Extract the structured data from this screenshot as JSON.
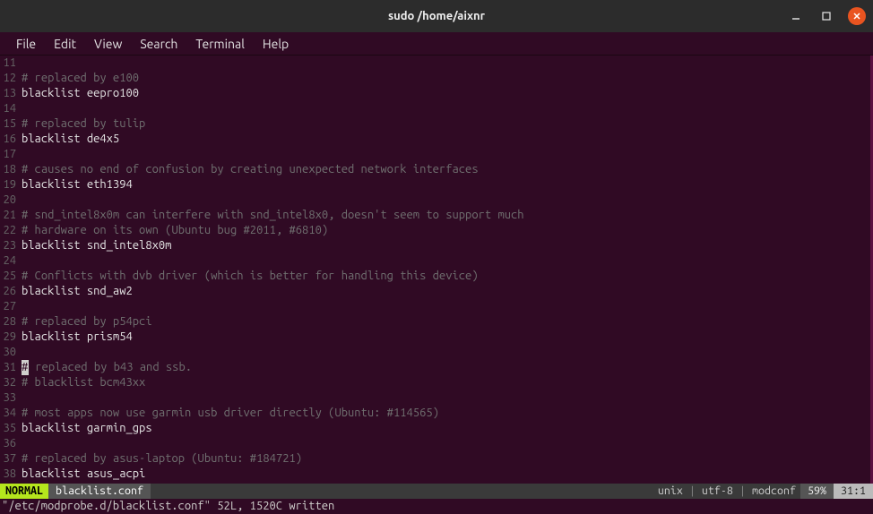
{
  "window": {
    "title": "sudo  /home/aixnr"
  },
  "menu": {
    "file": "File",
    "edit": "Edit",
    "view": "View",
    "search": "Search",
    "terminal": "Terminal",
    "help": "Help"
  },
  "editor": {
    "cursor_line": 31,
    "cursor_col": 1,
    "cursor_char": "#",
    "lines": [
      {
        "n": 11,
        "type": "blank",
        "text": ""
      },
      {
        "n": 12,
        "type": "comment",
        "text": "# replaced by e100"
      },
      {
        "n": 13,
        "type": "blacklist",
        "kw": "blacklist",
        "mod": "eepro100"
      },
      {
        "n": 14,
        "type": "blank",
        "text": ""
      },
      {
        "n": 15,
        "type": "comment",
        "text": "# replaced by tulip"
      },
      {
        "n": 16,
        "type": "blacklist",
        "kw": "blacklist",
        "mod": "de4x5"
      },
      {
        "n": 17,
        "type": "blank",
        "text": ""
      },
      {
        "n": 18,
        "type": "comment",
        "text": "# causes no end of confusion by creating unexpected network interfaces"
      },
      {
        "n": 19,
        "type": "blacklist",
        "kw": "blacklist",
        "mod": "eth1394"
      },
      {
        "n": 20,
        "type": "blank",
        "text": ""
      },
      {
        "n": 21,
        "type": "comment",
        "text": "# snd_intel8x0m can interfere with snd_intel8x0, doesn't seem to support much"
      },
      {
        "n": 22,
        "type": "comment",
        "text": "# hardware on its own (Ubuntu bug #2011, #6810)"
      },
      {
        "n": 23,
        "type": "blacklist",
        "kw": "blacklist",
        "mod": "snd_intel8x0m"
      },
      {
        "n": 24,
        "type": "blank",
        "text": ""
      },
      {
        "n": 25,
        "type": "comment",
        "text": "# Conflicts with dvb driver (which is better for handling this device)"
      },
      {
        "n": 26,
        "type": "blacklist",
        "kw": "blacklist",
        "mod": "snd_aw2"
      },
      {
        "n": 27,
        "type": "blank",
        "text": ""
      },
      {
        "n": 28,
        "type": "comment",
        "text": "# replaced by p54pci"
      },
      {
        "n": 29,
        "type": "blacklist",
        "kw": "blacklist",
        "mod": "prism54"
      },
      {
        "n": 30,
        "type": "blank",
        "text": ""
      },
      {
        "n": 31,
        "type": "cursor_comment",
        "rest": " replaced by b43 and ssb."
      },
      {
        "n": 32,
        "type": "comment",
        "text": "# blacklist bcm43xx"
      },
      {
        "n": 33,
        "type": "blank",
        "text": ""
      },
      {
        "n": 34,
        "type": "comment",
        "text": "# most apps now use garmin usb driver directly (Ubuntu: #114565)"
      },
      {
        "n": 35,
        "type": "blacklist",
        "kw": "blacklist",
        "mod": "garmin_gps"
      },
      {
        "n": 36,
        "type": "blank",
        "text": ""
      },
      {
        "n": 37,
        "type": "comment",
        "text": "# replaced by asus-laptop (Ubuntu: #184721)"
      },
      {
        "n": 38,
        "type": "blacklist",
        "kw": "blacklist",
        "mod": "asus_acpi"
      }
    ]
  },
  "status": {
    "mode": "NORMAL",
    "filename": "blacklist.conf",
    "ff": "unix",
    "enc": "utf-8",
    "ft": "modconf",
    "percent": "59%",
    "pos": "31:1"
  },
  "message": "\"/etc/modprobe.d/blacklist.conf\" 52L, 1520C written"
}
